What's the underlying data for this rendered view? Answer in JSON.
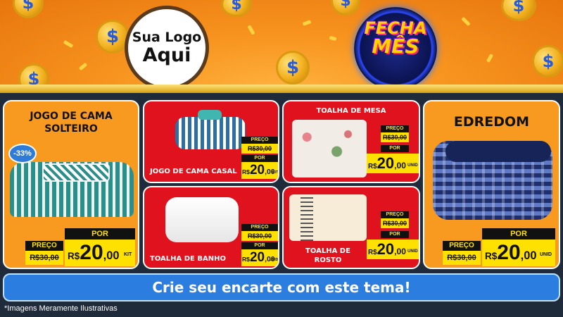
{
  "logo": {
    "line1": "Sua Logo",
    "line2": "Aqui"
  },
  "seal": {
    "line1": "FECHA",
    "line2": "MÊS"
  },
  "products": {
    "cama_solteiro": {
      "title_l1": "JOGO DE CAMA",
      "title_l2": "SOLTEIRO",
      "discount": "-33%",
      "preco_label": "PREÇO",
      "old_price": "R$30,00",
      "por_label": "POR",
      "currency": "R$",
      "price_int": "20",
      "price_cents": ",00",
      "unit": "KIT"
    },
    "cama_casal": {
      "title": "JOGO DE CAMA CASAL",
      "preco_label": "PREÇO",
      "old_price": "R$30,00",
      "por_label": "POR",
      "currency": "R$",
      "price_int": "20",
      "price_cents": ",00",
      "unit": "KIT"
    },
    "toalha_mesa": {
      "title": "TOALHA DE MESA",
      "preco_label": "PREÇO",
      "old_price": "R$30,00",
      "por_label": "POR",
      "currency": "R$",
      "price_int": "20",
      "price_cents": ",00",
      "unit": "UNID"
    },
    "edredom": {
      "title": "EDREDOM",
      "preco_label": "PREÇO",
      "old_price": "R$30,00",
      "por_label": "POR",
      "currency": "R$",
      "price_int": "20",
      "price_cents": ",00",
      "unit": "UNID"
    },
    "toalha_banho": {
      "title": "TOALHA DE BANHO",
      "preco_label": "PREÇO",
      "old_price": "R$30,00",
      "por_label": "POR",
      "currency": "R$",
      "price_int": "20",
      "price_cents": ",00",
      "unit": "UNID"
    },
    "toalha_rosto": {
      "title_l1": "TOALHA DE",
      "title_l2": "ROSTO",
      "preco_label": "PREÇO",
      "old_price": "R$30,00",
      "por_label": "POR",
      "currency": "R$",
      "price_int": "20",
      "price_cents": ",00",
      "unit": "UNID"
    }
  },
  "cta": "Crie seu encarte com este tema!",
  "footnote": "*Imagens Meramente Ilustrativas",
  "colors": {
    "orange": "#f89a1f",
    "red": "#e0121d",
    "yellow": "#ffe100",
    "blue": "#2b7ee0"
  },
  "icons": [
    "dollar-coin-icon",
    "confetti-icon"
  ]
}
